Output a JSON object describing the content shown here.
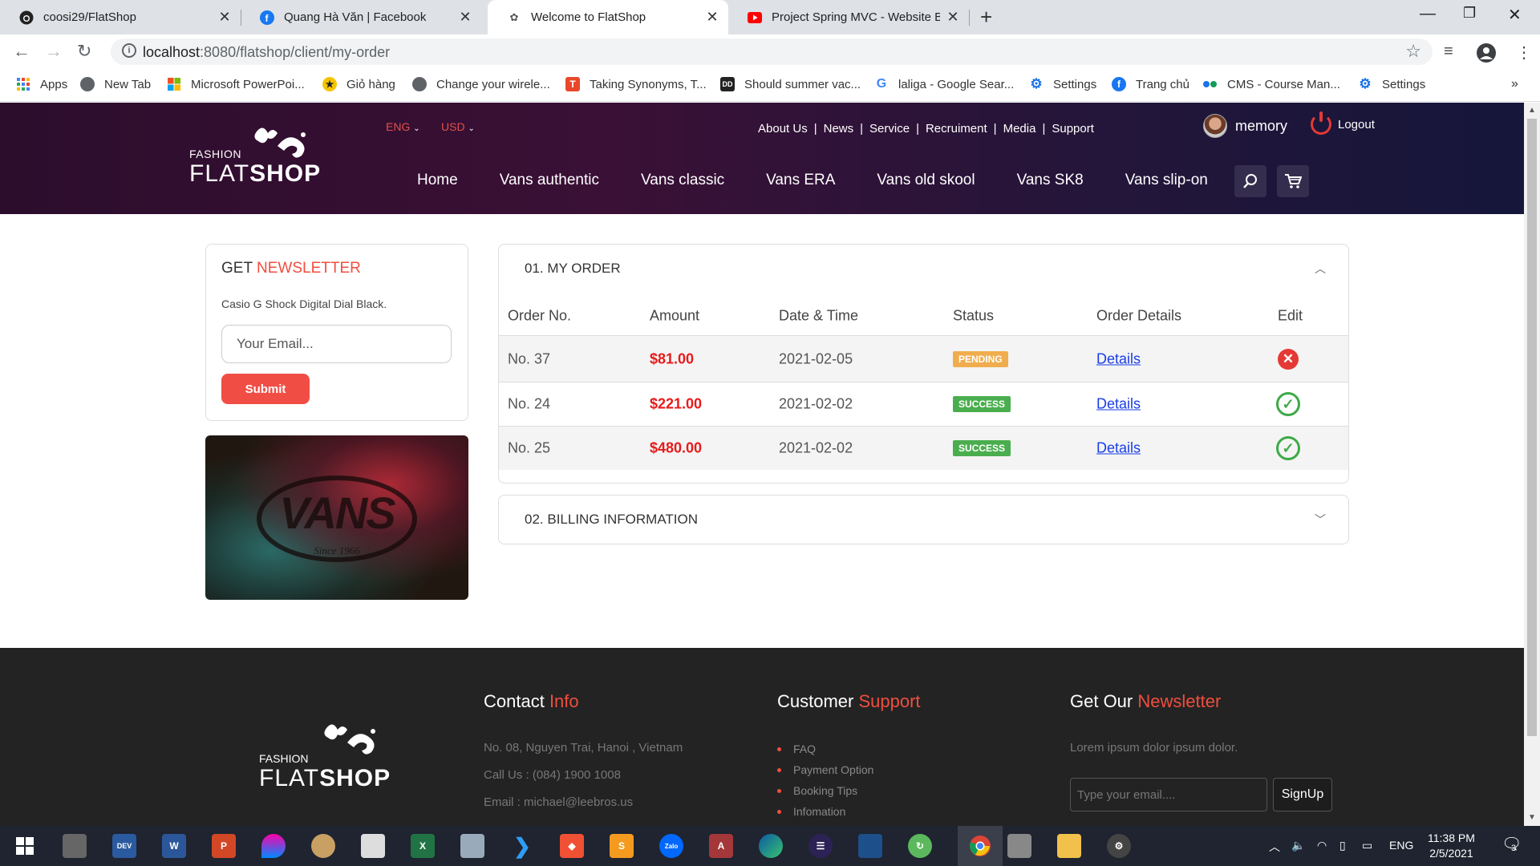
{
  "browser": {
    "tabs": [
      {
        "title": "coosi29/FlatShop",
        "icon": "github-icon"
      },
      {
        "title": "Quang Hà Văn | Facebook",
        "icon": "facebook-icon"
      },
      {
        "title": "Welcome to FlatShop",
        "icon": "flatshop-icon"
      },
      {
        "title": "Project Spring MVC - Website Bá",
        "icon": "youtube-icon"
      }
    ],
    "url_host": "localhost",
    "url_path": ":8080/flatshop/client/my-order",
    "bookmarks": [
      {
        "label": "Apps",
        "color": "#4285f4"
      },
      {
        "label": "New Tab",
        "color": "#5f6368"
      },
      {
        "label": "Microsoft PowerPoi...",
        "color": "#f25022"
      },
      {
        "label": "Giỏ hàng",
        "color": "#f5c400"
      },
      {
        "label": "Change your wirele...",
        "color": "#5f6368"
      },
      {
        "label": "Taking Synonyms, T...",
        "color": "#e8472b"
      },
      {
        "label": "Should summer vac...",
        "color": "#222222"
      },
      {
        "label": "laliga - Google Sear...",
        "color": "#4285f4"
      },
      {
        "label": "Settings",
        "color": "#1a73e8"
      },
      {
        "label": "Trang chủ",
        "color": "#1877f2"
      },
      {
        "label": "CMS - Course Man...",
        "color": "#0f9d58"
      },
      {
        "label": "Settings",
        "color": "#1a73e8"
      }
    ]
  },
  "site": {
    "logo": {
      "fashion": "FASHION",
      "flat": "FLAT",
      "shop": "SHOP"
    },
    "lang": "ENG",
    "currency": "USD",
    "top_links": [
      "About Us",
      "News",
      "Service",
      "Recruiment",
      "Media",
      "Support"
    ],
    "username": "memory",
    "logout": "Logout",
    "main_nav": [
      "Home",
      "Vans authentic",
      "Vans classic",
      "Vans ERA",
      "Vans old skool",
      "Vans SK8",
      "Vans slip-on"
    ]
  },
  "sidebar": {
    "nl_title_plain": "GET ",
    "nl_title_accent": "NEWSLETTER",
    "nl_desc": "Casio G Shock Digital Dial Black.",
    "nl_placeholder": "Your Email...",
    "nl_submit": "Submit",
    "banner_word": "VANS",
    "banner_since": "Since 1966"
  },
  "orders": {
    "section_title": "01. MY ORDER",
    "columns": [
      "Order No.",
      "Amount",
      "Date & Time",
      "Status",
      "Order Details",
      "Edit"
    ],
    "rows": [
      {
        "no": "No. 37",
        "amount": "$81.00",
        "date": "2021-02-05",
        "status": "PENDING",
        "details": "Details",
        "edit": "cancel"
      },
      {
        "no": "No. 24",
        "amount": "$221.00",
        "date": "2021-02-02",
        "status": "SUCCESS",
        "details": "Details",
        "edit": "done"
      },
      {
        "no": "No. 25",
        "amount": "$480.00",
        "date": "2021-02-02",
        "status": "SUCCESS",
        "details": "Details",
        "edit": "done"
      }
    ],
    "billing_title": "02. BILLING INFORMATION"
  },
  "footer": {
    "contact_title_plain": "Contact ",
    "contact_title_accent": "Info",
    "address": "No. 08, Nguyen Trai, Hanoi , Vietnam",
    "phone": "Call Us : (084) 1900 1008",
    "email": "Email : michael@leebros.us",
    "support_title_plain": "Customer ",
    "support_title_accent": "Support",
    "support_links": [
      "FAQ",
      "Payment Option",
      "Booking Tips",
      "Infomation"
    ],
    "news_title_plain": "Get Our ",
    "news_title_accent": "Newsletter",
    "news_desc": "Lorem ipsum dolor ipsum dolor.",
    "news_placeholder": "Type your email....",
    "news_button": "SignUp"
  },
  "taskbar": {
    "lang": "ENG",
    "time": "11:38 PM",
    "date": "2/5/2021",
    "notifications": "3"
  }
}
